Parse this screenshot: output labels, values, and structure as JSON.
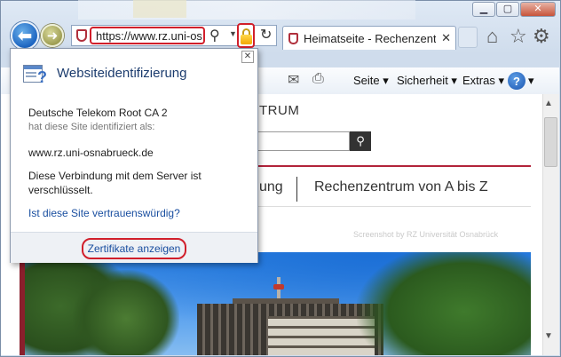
{
  "window": {
    "minimize_glyph": "▁",
    "maximize_glyph": "▢",
    "close_glyph": "✕"
  },
  "nav": {
    "back_glyph": "⬅",
    "forward_glyph": "➜",
    "address_url": "https://www.rz.uni-os",
    "search_glyph": "⚲",
    "dropdown_glyph": "▼",
    "refresh_glyph": "↻"
  },
  "tab": {
    "title": "Heimatseite - Rechenzentrum ...",
    "close_glyph": "✕"
  },
  "toolbar_icons": {
    "home": "⌂",
    "favorites": "☆",
    "tools": "⚙"
  },
  "command_bar": {
    "mail_glyph": "✉",
    "print_glyph": "⎙",
    "seite": "Seite ▾",
    "sicherheit": "Sicherheit ▾",
    "extras": "Extras ▾",
    "help_glyph": "?",
    "help_drop": "▾"
  },
  "website": {
    "brand_fragment": "TRUM",
    "search_btn_glyph": "⚲",
    "nav_fragment": "ung",
    "nav_az": "Rechenzentrum von A bis Z",
    "watermark": "Screenshot by RZ Universität Osnabrück"
  },
  "scrollbar": {
    "up_glyph": "▲",
    "down_glyph": "▼"
  },
  "popup": {
    "close_glyph": "✕",
    "title": "Websiteidentifizierung",
    "issuer": "Deutsche Telekom Root CA 2",
    "issuer_sub": "hat diese Site identifiziert als:",
    "site": "www.rz.uni-osnabrueck.de",
    "encryption_line1": "Diese Verbindung mit dem Server ist",
    "encryption_line2": "verschlüsselt.",
    "trust_link": "Ist diese Site vertrauenswürdig?",
    "cert_button": "Zertifikate anzeigen"
  },
  "colors": {
    "highlight_red": "#d11f2b",
    "link_blue": "#1a4fa0",
    "site_accent": "#b2233a"
  }
}
